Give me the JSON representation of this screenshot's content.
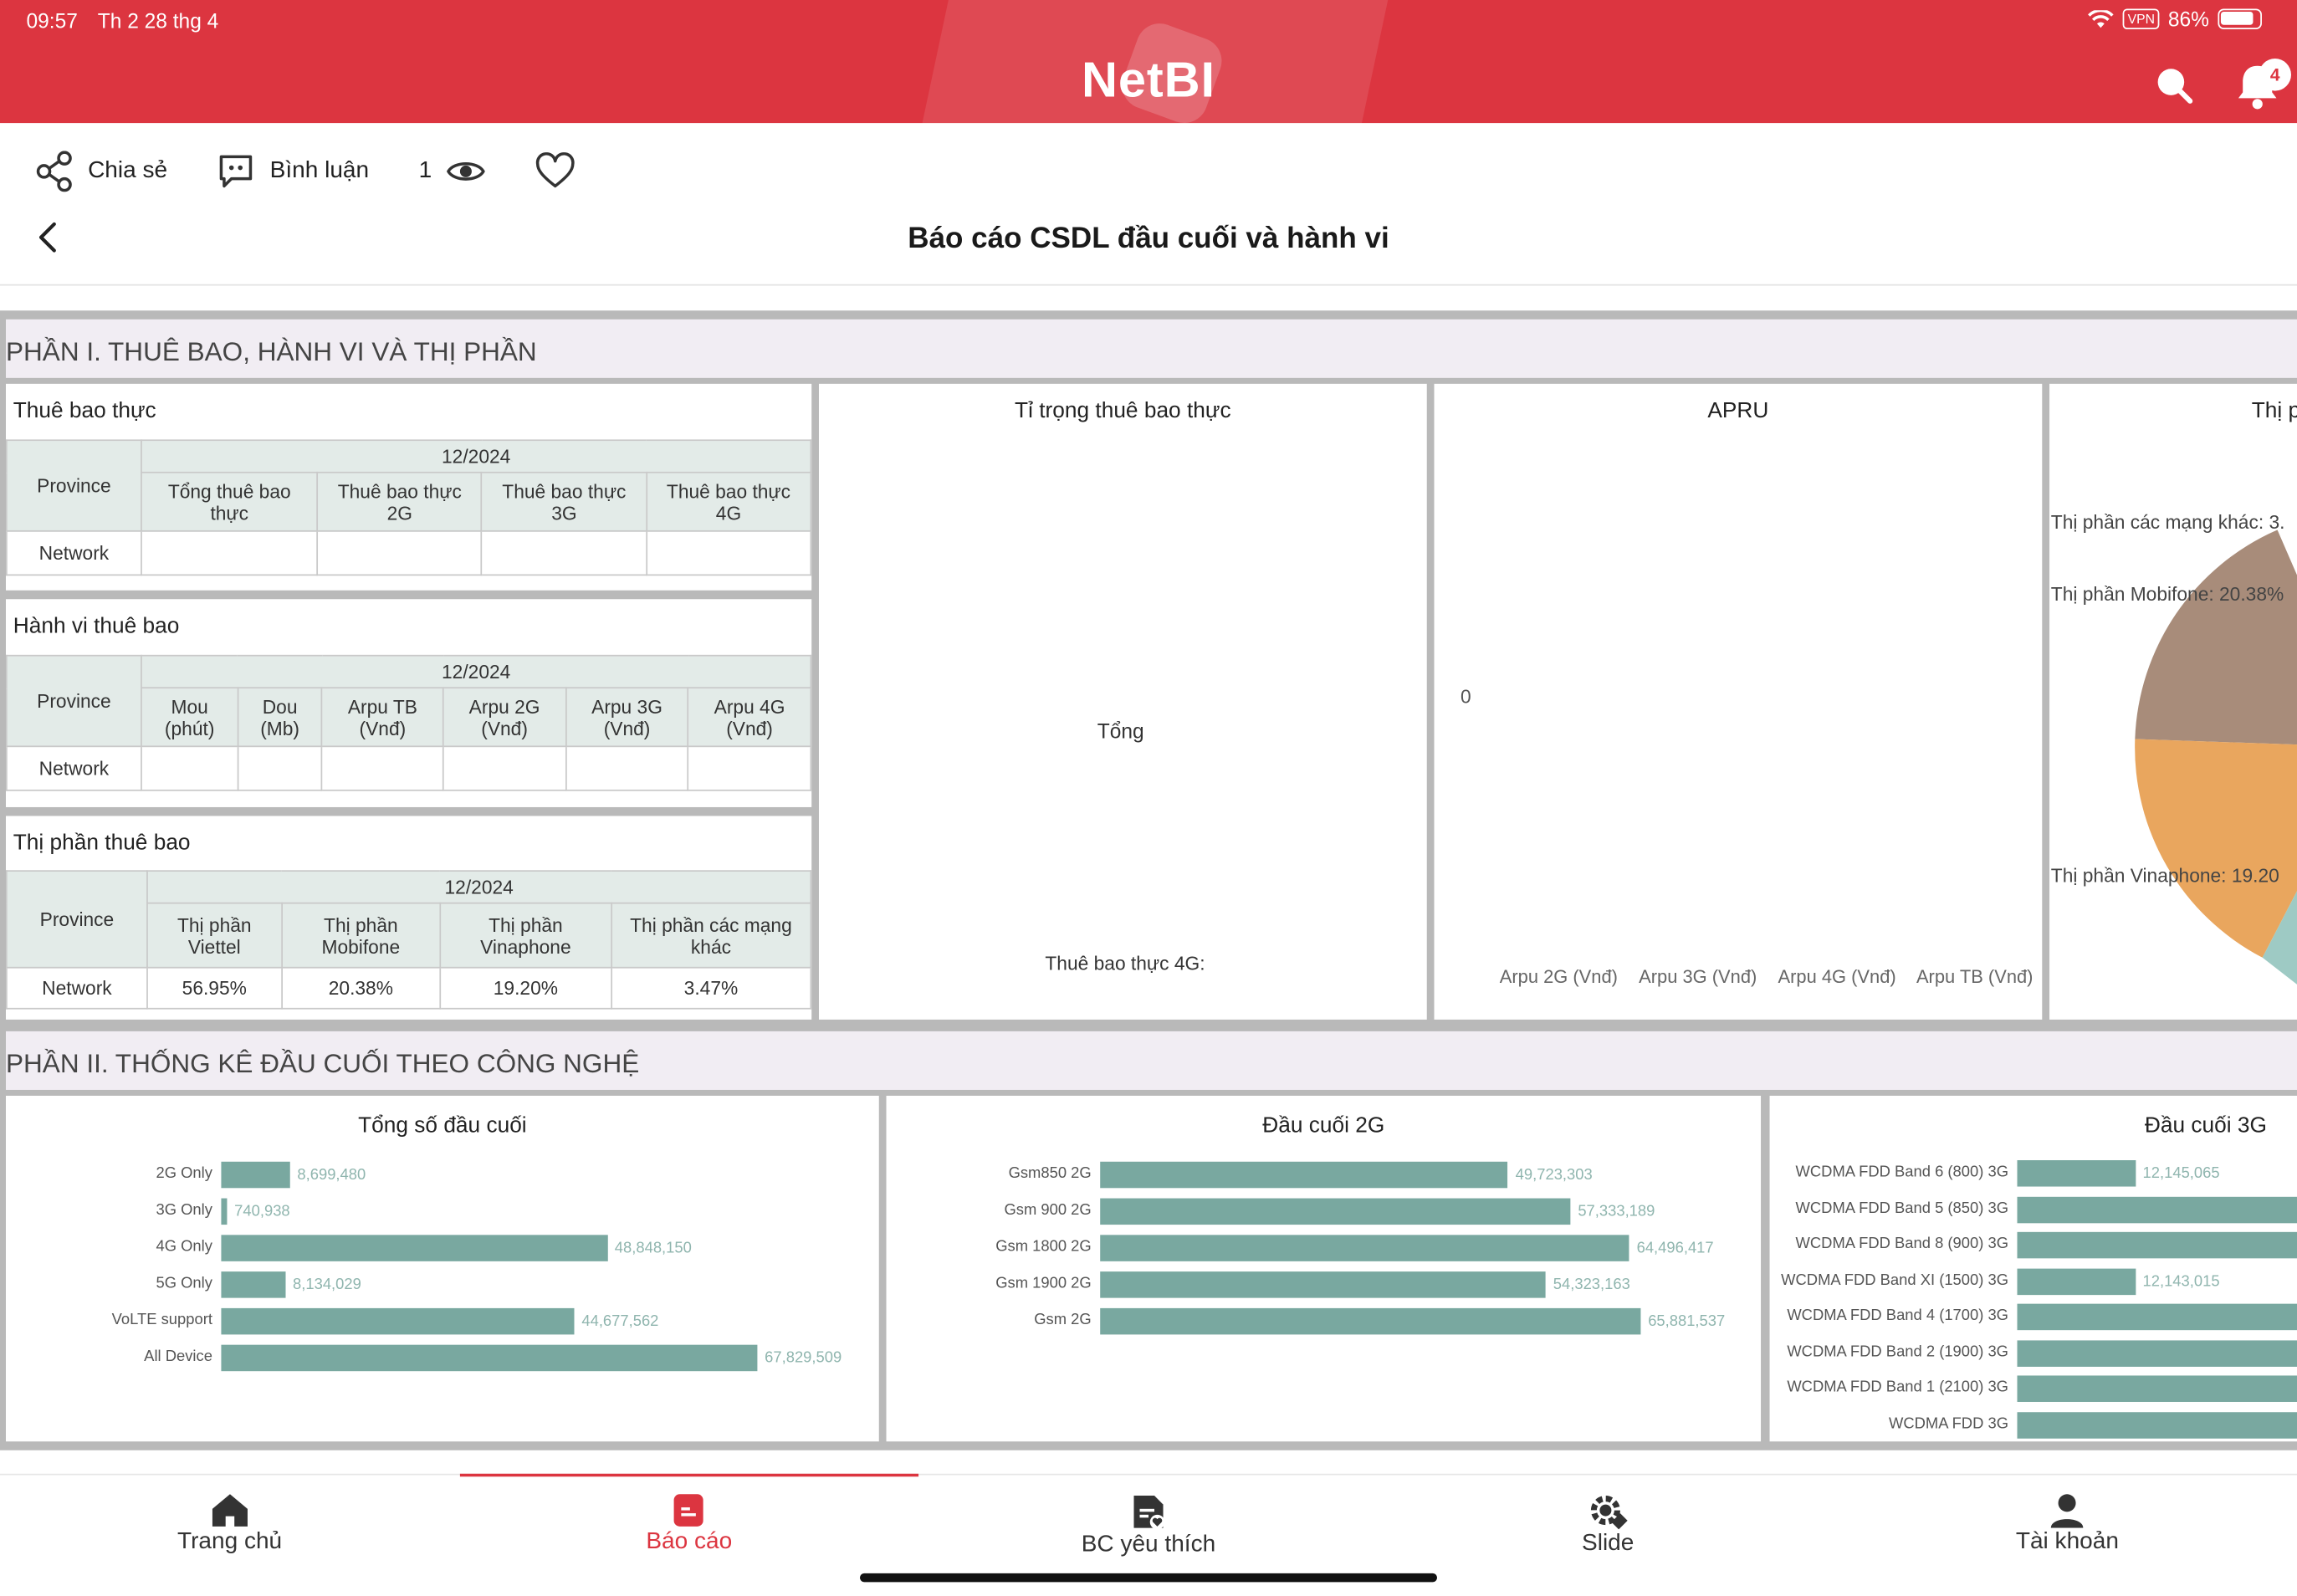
{
  "status": {
    "time": "09:57",
    "date": "Th 2 28 thg 4",
    "vpn": "VPN",
    "battery": "86%"
  },
  "app": {
    "title": "NetBI",
    "notification_count": "4",
    "accent": "#dc3540"
  },
  "actions": {
    "share": "Chia sẻ",
    "comment": "Bình luận",
    "views": "1"
  },
  "report": {
    "title": "Báo cáo CSDL đầu cuối và hành vi"
  },
  "section1": {
    "heading": "PHẦN I. THUÊ BAO, HÀNH VI VÀ THỊ PHẦN",
    "subs_panel": {
      "title": "Thuê bao thực",
      "period": "12/2024",
      "row_header": "Province",
      "columns": [
        "Tổng thuê bao thực",
        "Thuê bao thực 2G",
        "Thuê bao thực 3G",
        "Thuê bao thực 4G"
      ],
      "rows": [
        {
          "label": "Network",
          "values": [
            "",
            "",
            "",
            ""
          ]
        }
      ]
    },
    "behavior_panel": {
      "title": "Hành vi thuê bao",
      "period": "12/2024",
      "row_header": "Province",
      "columns": [
        "Mou (phút)",
        "Dou (Mb)",
        "Arpu TB (Vnđ)",
        "Arpu 2G (Vnđ)",
        "Arpu 3G (Vnđ)",
        "Arpu 4G (Vnđ)"
      ],
      "rows": [
        {
          "label": "Network",
          "values": [
            "",
            "",
            "",
            "",
            "",
            ""
          ]
        }
      ]
    },
    "share_panel": {
      "title": "Thị phần thuê bao",
      "period": "12/2024",
      "row_header": "Province",
      "columns": [
        "Thị phần Viettel",
        "Thị phần Mobifone",
        "Thị phần Vinaphone",
        "Thị phần các mạng khác"
      ],
      "rows": [
        {
          "label": "Network",
          "values": [
            "56.95%",
            "20.38%",
            "19.20%",
            "3.47%"
          ]
        }
      ]
    },
    "ratio_panel": {
      "title": "Tỉ trọng thuê bao thực",
      "center": "Tổng",
      "footer": "Thuê bao thực 4G:"
    },
    "arpu_panel": {
      "title": "APRU",
      "zero": "0",
      "xlabels": [
        "Arpu 2G (Vnđ)",
        "Arpu 3G (Vnđ)",
        "Arpu 4G (Vnđ)",
        "Arpu TB (Vnđ)"
      ]
    },
    "market_panel": {
      "title": "Thị p",
      "labels": [
        "Thị phần các mạng khác: 3.",
        "Thị phần Mobifone: 20.38%",
        "Thị phần Vinaphone: 19.20"
      ],
      "colors": {
        "mobifone": "#a88c7a",
        "vinaphone": "#e9a65e",
        "other": "#9ecac4"
      }
    }
  },
  "section2": {
    "heading": "PHẦN II. THỐNG KÊ ĐẦU CUỐI THEO CÔNG NGHỆ",
    "bar_color": "#79a8a0",
    "charts": [
      {
        "title": "Tổng số đầu cuối",
        "bars": [
          {
            "label": "2G Only",
            "value": 8699480,
            "text": "8,699,480"
          },
          {
            "label": "3G Only",
            "value": 740938,
            "text": "740,938"
          },
          {
            "label": "4G Only",
            "value": 48848150,
            "text": "48,848,150"
          },
          {
            "label": "5G Only",
            "value": 8134029,
            "text": "8,134,029"
          },
          {
            "label": "VoLTE support",
            "value": 44677562,
            "text": "44,677,562"
          },
          {
            "label": "All Device",
            "value": 67829509,
            "text": "67,829,509"
          }
        ]
      },
      {
        "title": "Đầu cuối 2G",
        "bars": [
          {
            "label": "Gsm850 2G",
            "value": 49723303,
            "text": "49,723,303"
          },
          {
            "label": "Gsm 900 2G",
            "value": 57333189,
            "text": "57,333,189"
          },
          {
            "label": "Gsm 1800 2G",
            "value": 64496417,
            "text": "64,496,417"
          },
          {
            "label": "Gsm 1900 2G",
            "value": 54323163,
            "text": "54,323,163"
          },
          {
            "label": "Gsm 2G",
            "value": 65881537,
            "text": "65,881,537"
          }
        ]
      },
      {
        "title": "Đầu cuối 3G",
        "bars": [
          {
            "label": "WCDMA FDD Band 6 (800) 3G",
            "value": 12145065,
            "text": "12,145,065"
          },
          {
            "label": "WCDMA FDD Band 5 (850) 3G",
            "value": null,
            "text": ""
          },
          {
            "label": "WCDMA FDD Band 8 (900) 3G",
            "value": null,
            "text": ""
          },
          {
            "label": "WCDMA FDD Band XI (1500) 3G",
            "value": 12143015,
            "text": "12,143,015"
          },
          {
            "label": "WCDMA FDD Band 4 (1700) 3G",
            "value": null,
            "text": ""
          },
          {
            "label": "WCDMA FDD Band 2 (1900) 3G",
            "value": null,
            "text": ""
          },
          {
            "label": "WCDMA FDD Band 1 (2100) 3G",
            "value": null,
            "text": ""
          },
          {
            "label": "WCDMA FDD 3G",
            "value": null,
            "text": ""
          }
        ]
      }
    ]
  },
  "nav": {
    "items": [
      "Trang chủ",
      "Báo cáo",
      "BC yêu thích",
      "Slide",
      "Tài khoản"
    ],
    "active": "Báo cáo"
  }
}
